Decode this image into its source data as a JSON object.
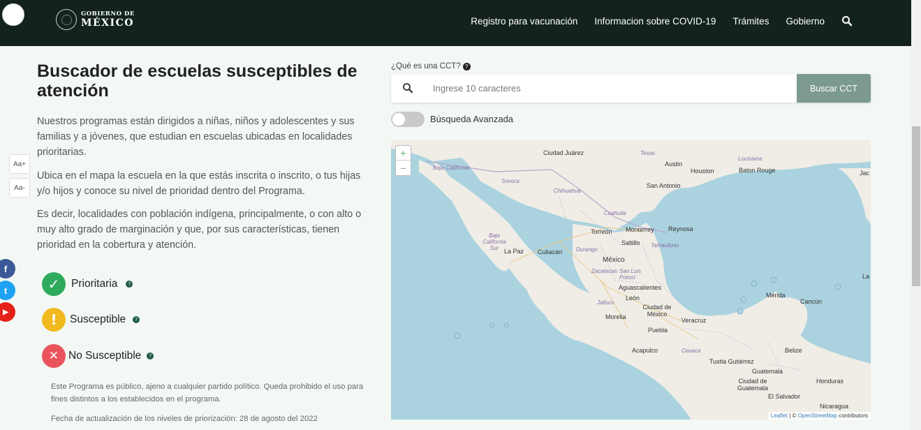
{
  "header": {
    "logo_line1": "GOBIERNO DE",
    "logo_line2": "MÉXICO",
    "nav": [
      "Registro para vacunación",
      "Informacion sobre COVID-19",
      "Trámites",
      "Gobierno"
    ]
  },
  "main": {
    "title": "Buscador de escuelas susceptibles de atención",
    "paragraphs": [
      "Nuestros programas están dirigidos a niñas, niños y adolescentes y sus familias y a jóvenes, que estudian en escuelas ubicadas en localidades prioritarias.",
      "Ubica en el mapa la escuela en la que estás inscrita o inscrito, o tus hijas y/o hijos y conoce su nivel de prioridad dentro del Programa.",
      "Es decir, localidades con población indígena, principalmente, o con alto o muy alto grado de marginación y que, por sus características, tienen prioridad en la cobertura y atención."
    ],
    "legend": [
      {
        "label": "Prioritaria",
        "color": "#2eaa5c",
        "icon": "check-icon",
        "glyph": "✓"
      },
      {
        "label": "Susceptible",
        "color": "#f0b91d",
        "icon": "exclamation-icon",
        "glyph": "!"
      },
      {
        "label": "No Susceptible",
        "color": "#e9545c",
        "icon": "x-icon",
        "glyph": "✕"
      }
    ],
    "footnote": "Este Programa es público, ajeno a cualquier partido político. Queda prohibido el uso para fines distintos a los establecidos en el programa.",
    "update": "Fecha de actualización de los niveles de priorización: 28 de agosto del 2022"
  },
  "font_controls": {
    "increase": "Aa+",
    "decrease": "Aa-"
  },
  "social": [
    {
      "name": "facebook",
      "color": "#3b5998",
      "glyph": "f"
    },
    {
      "name": "twitter",
      "color": "#1da1f2",
      "glyph": "t"
    },
    {
      "name": "youtube",
      "color": "#e62117",
      "glyph": "▶"
    }
  ],
  "search": {
    "cct_question": "¿Qué es una CCT?",
    "placeholder": "Ingrese 10 caracteres",
    "button": "Buscar CCT",
    "advanced_label": "Búsqueda Avanzada"
  },
  "map": {
    "zoom_in": "+",
    "zoom_out": "−",
    "attribution_leaflet": "Leaflet",
    "attribution_osm": "OpenStreetMap",
    "attribution_rest": "contributors",
    "labels": [
      {
        "text": "Ciudad Juárez",
        "type": "city"
      },
      {
        "text": "Texas",
        "type": "state"
      },
      {
        "text": "Louisiana",
        "type": "state"
      },
      {
        "text": "Austin",
        "type": "city"
      },
      {
        "text": "Houston",
        "type": "city"
      },
      {
        "text": "Baton Rouge",
        "type": "city"
      },
      {
        "text": "Jac",
        "type": "city"
      },
      {
        "text": "Baja California",
        "type": "state"
      },
      {
        "text": "Sonora",
        "type": "state"
      },
      {
        "text": "Chihuahua",
        "type": "state"
      },
      {
        "text": "San Antonio",
        "type": "city"
      },
      {
        "text": "Coahuila",
        "type": "state"
      },
      {
        "text": "Torreón",
        "type": "city"
      },
      {
        "text": "Monterrey",
        "type": "city"
      },
      {
        "text": "Reynosa",
        "type": "city"
      },
      {
        "text": "Saltillo",
        "type": "city"
      },
      {
        "text": "Tamaulipas",
        "type": "state"
      },
      {
        "text": "Baja California Sur",
        "type": "state"
      },
      {
        "text": "La Paz",
        "type": "city"
      },
      {
        "text": "Culiacán",
        "type": "city"
      },
      {
        "text": "Durango",
        "type": "state"
      },
      {
        "text": "México",
        "type": "city"
      },
      {
        "text": "Zacatecas",
        "type": "state"
      },
      {
        "text": "San Luis Potosí",
        "type": "state"
      },
      {
        "text": "Aguascalientes",
        "type": "city"
      },
      {
        "text": "León",
        "type": "city"
      },
      {
        "text": "Jalisco",
        "type": "state"
      },
      {
        "text": "Ciudad de México",
        "type": "city"
      },
      {
        "text": "Morelia",
        "type": "city"
      },
      {
        "text": "Veracruz",
        "type": "city"
      },
      {
        "text": "Puebla",
        "type": "city"
      },
      {
        "text": "Mérida",
        "type": "city"
      },
      {
        "text": "Cancún",
        "type": "city"
      },
      {
        "text": "La Ha",
        "type": "city"
      },
      {
        "text": "Acapulco",
        "type": "city"
      },
      {
        "text": "Oaxaca",
        "type": "state"
      },
      {
        "text": "Tuxtla Gutiérrez",
        "type": "city"
      },
      {
        "text": "Belize",
        "type": "city"
      },
      {
        "text": "Guatemala",
        "type": "city"
      },
      {
        "text": "Ciudad de Guatemala",
        "type": "city"
      },
      {
        "text": "Honduras",
        "type": "city"
      },
      {
        "text": "El Salvador",
        "type": "city"
      },
      {
        "text": "Nicaragua",
        "type": "city"
      }
    ]
  }
}
